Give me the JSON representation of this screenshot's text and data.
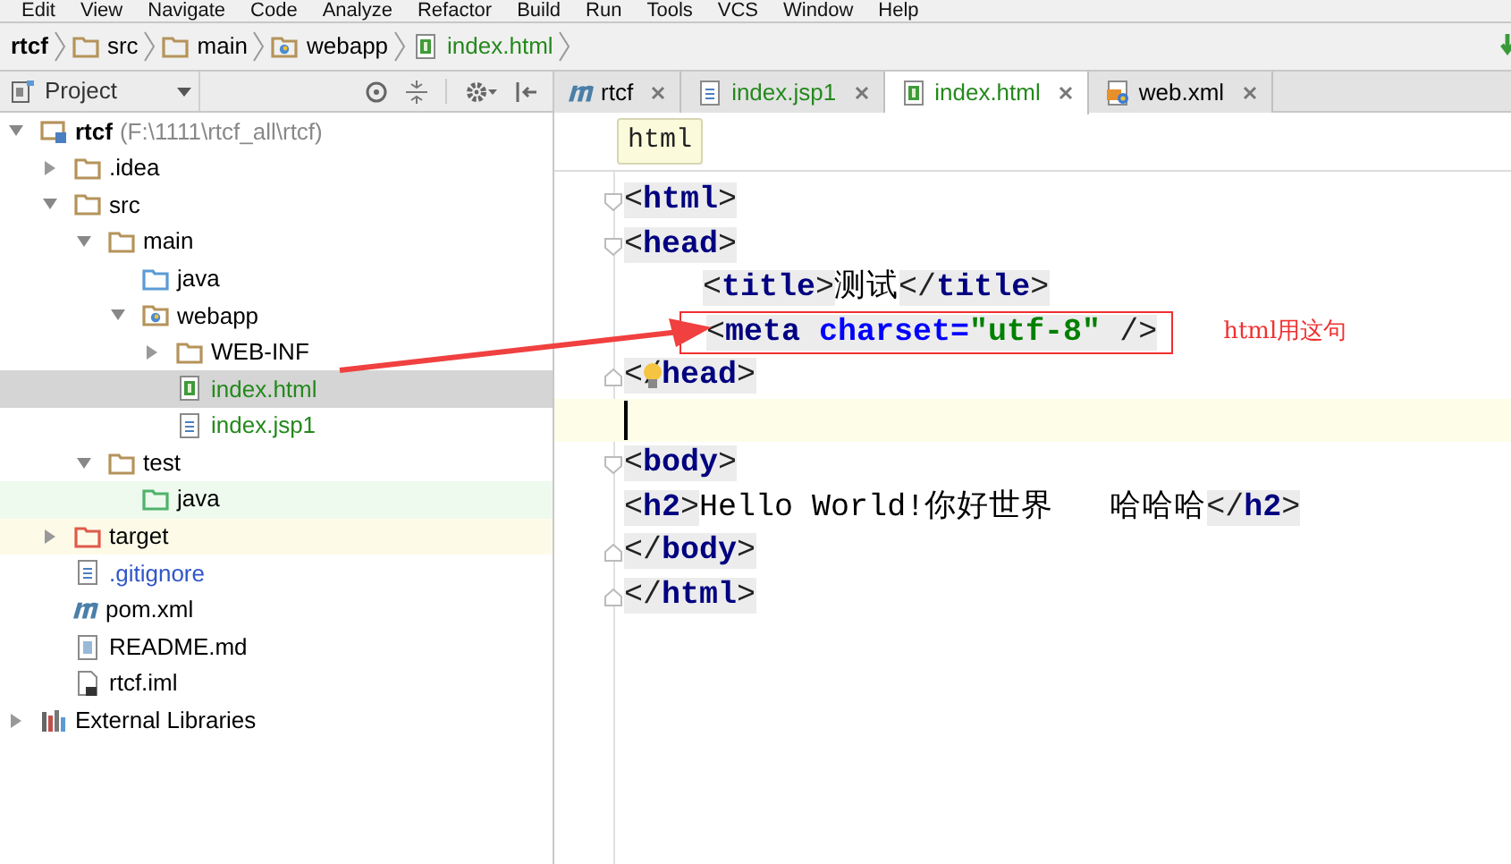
{
  "menu_bar": [
    "Edit",
    "View",
    "Navigate",
    "Code",
    "Analyze",
    "Refactor",
    "Build",
    "Run",
    "Tools",
    "VCS",
    "Window",
    "Help"
  ],
  "breadcrumbs": [
    {
      "label": "rtcf",
      "kind": "project",
      "color": "#000000"
    },
    {
      "label": "src",
      "kind": "folder",
      "color": "#000000"
    },
    {
      "label": "main",
      "kind": "folder",
      "color": "#000000"
    },
    {
      "label": "webapp",
      "kind": "resource",
      "color": "#000000"
    },
    {
      "label": "index.html",
      "kind": "html",
      "color": "#24891c"
    }
  ],
  "project_panel": {
    "title": "Project",
    "tree": [
      {
        "label": "rtcf",
        "hint": "(F:\\1111\\rtcf_all\\rtcf)",
        "kind": "project",
        "expanded": true,
        "selected": false,
        "color": "#000000",
        "children": [
          {
            "label": ".idea",
            "kind": "folder",
            "expanded": false,
            "selected": false,
            "color": "#000000"
          },
          {
            "label": "src",
            "kind": "folder",
            "expanded": true,
            "selected": false,
            "color": "#000000",
            "children": [
              {
                "label": "main",
                "kind": "folder",
                "expanded": true,
                "selected": false,
                "color": "#000000",
                "children": [
                  {
                    "label": "java",
                    "kind": "source",
                    "selected": false,
                    "color": "#000000"
                  },
                  {
                    "label": "webapp",
                    "kind": "resource",
                    "expanded": true,
                    "selected": false,
                    "color": "#000000",
                    "children": [
                      {
                        "label": "WEB-INF",
                        "kind": "folder",
                        "expanded": false,
                        "selected": false,
                        "color": "#000000"
                      },
                      {
                        "label": "index.html",
                        "kind": "html",
                        "selected": true,
                        "color": "#24891c"
                      },
                      {
                        "label": "index.jsp1",
                        "kind": "text",
                        "selected": false,
                        "color": "#24891c"
                      }
                    ]
                  }
                ]
              },
              {
                "label": "test",
                "kind": "folder",
                "expanded": true,
                "selected": false,
                "color": "#000000",
                "children": [
                  {
                    "label": "java",
                    "kind": "test_source",
                    "selected": false,
                    "color": "#000000"
                  }
                ]
              }
            ]
          },
          {
            "label": "target",
            "kind": "excluded",
            "expanded": false,
            "selected": false,
            "color": "#000000"
          },
          {
            "label": ".gitignore",
            "kind": "text",
            "selected": false,
            "color": "#2f55c9"
          },
          {
            "label": "pom.xml",
            "kind": "maven",
            "selected": false,
            "color": "#000000"
          },
          {
            "label": "README.md",
            "kind": "markdown",
            "selected": false,
            "color": "#000000"
          },
          {
            "label": "rtcf.iml",
            "kind": "iml",
            "selected": false,
            "color": "#000000"
          }
        ]
      },
      {
        "label": "External Libraries",
        "kind": "libraries",
        "expanded": false,
        "selected": false,
        "color": "#000000"
      }
    ]
  },
  "editor_tabs": [
    {
      "label": "rtcf",
      "kind": "maven",
      "selected": false,
      "color": "#000000"
    },
    {
      "label": "index.jsp1",
      "kind": "text",
      "selected": false,
      "color": "#24891c"
    },
    {
      "label": "index.html",
      "kind": "html",
      "selected": true,
      "color": "#24891c"
    },
    {
      "label": "web.xml",
      "kind": "xml",
      "selected": false,
      "color": "#000000"
    }
  ],
  "editor": {
    "breadcrumb_tooltip": "html",
    "lines": [
      {
        "fold_start": true,
        "tokens": [
          {
            "kind": "punct",
            "text": "<"
          },
          {
            "kind": "tag",
            "text": "html"
          },
          {
            "kind": "punct",
            "text": ">"
          }
        ]
      },
      {
        "fold_start": true,
        "tokens": [
          {
            "kind": "punct",
            "text": "<"
          },
          {
            "kind": "tag",
            "text": "head"
          },
          {
            "kind": "punct",
            "text": ">"
          }
        ]
      },
      {
        "indent": true,
        "tokens": [
          {
            "kind": "punct",
            "text": "<"
          },
          {
            "kind": "tag",
            "text": "title"
          },
          {
            "kind": "punct",
            "text": ">"
          },
          {
            "kind": "text",
            "text": "测试"
          },
          {
            "kind": "punct",
            "text": "</"
          },
          {
            "kind": "tag",
            "text": "title"
          },
          {
            "kind": "punct",
            "text": ">"
          }
        ]
      },
      {
        "indent": true,
        "boxed": true,
        "tokens": [
          {
            "kind": "punct",
            "text": "<"
          },
          {
            "kind": "tag",
            "text": "meta"
          },
          {
            "kind": "attr",
            "text": " charset="
          },
          {
            "kind": "value",
            "text": "\"utf-8\""
          },
          {
            "kind": "punct",
            "text": " />"
          }
        ]
      },
      {
        "fold_end": true,
        "bulb": true,
        "tokens": [
          {
            "kind": "punct",
            "text": "</"
          },
          {
            "kind": "tag",
            "text": "head"
          },
          {
            "kind": "punct",
            "text": ">"
          }
        ]
      },
      {
        "current": true
      },
      {
        "fold_start": true,
        "tokens": [
          {
            "kind": "punct",
            "text": "<"
          },
          {
            "kind": "tag",
            "text": "body"
          },
          {
            "kind": "punct",
            "text": ">"
          }
        ]
      },
      {
        "tokens": [
          {
            "kind": "punct",
            "text": "<"
          },
          {
            "kind": "tag",
            "text": "h2"
          },
          {
            "kind": "punct",
            "text": ">"
          },
          {
            "kind": "text",
            "text": "Hello World!你好世界   哈哈哈"
          },
          {
            "kind": "punct",
            "text": "</"
          },
          {
            "kind": "tag",
            "text": "h2"
          },
          {
            "kind": "punct",
            "text": ">"
          }
        ]
      },
      {
        "fold_end": true,
        "tokens": [
          {
            "kind": "punct",
            "text": "</"
          },
          {
            "kind": "tag",
            "text": "body"
          },
          {
            "kind": "punct",
            "text": ">"
          }
        ]
      },
      {
        "fold_end": true,
        "tokens": [
          {
            "kind": "punct",
            "text": "</"
          },
          {
            "kind": "tag",
            "text": "html"
          },
          {
            "kind": "punct",
            "text": ">"
          }
        ]
      }
    ],
    "annotation": "html用这句"
  }
}
